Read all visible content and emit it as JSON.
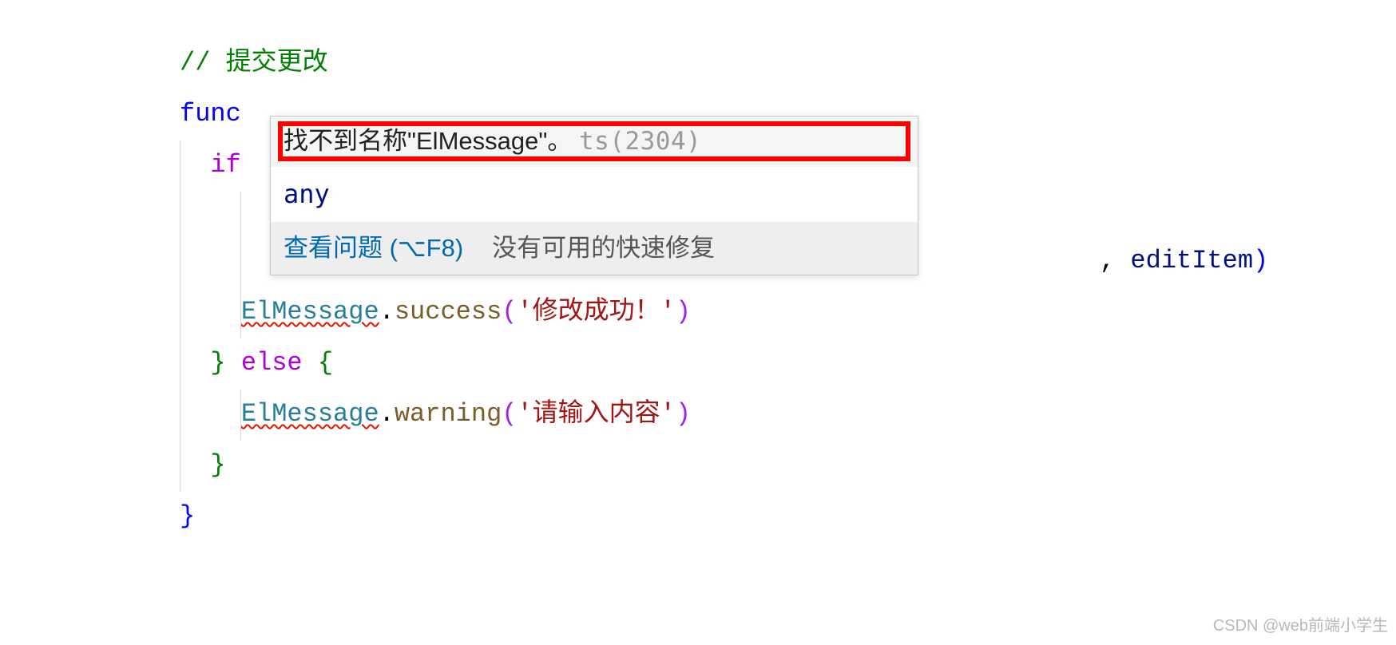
{
  "code": {
    "line1": {
      "comment_slash": "// ",
      "comment_text": "提交更改"
    },
    "line2": {
      "kw": "func"
    },
    "line3": {
      "kw": "if"
    },
    "line4_tail": {
      "comma": ", ",
      "var": "editItem",
      "paren": ")"
    },
    "line5": {
      "class": "ElMessage",
      "dot": ".",
      "method": "success",
      "paren_open": "(",
      "str": "'修改成功！'",
      "paren_close": ")"
    },
    "line6": {
      "brace_close": "}",
      "space": " ",
      "kw_else": "else",
      "space2": " ",
      "brace_open": "{"
    },
    "line7": {
      "class": "ElMessage",
      "dot": ".",
      "method": "warning",
      "paren_open": "(",
      "str": "'请输入内容'",
      "paren_close": ")"
    },
    "line8": {
      "brace": "}"
    },
    "line9": {
      "brace": "}"
    }
  },
  "hover": {
    "error_message": "找不到名称\"ElMessage\"。",
    "error_code": "ts(2304)",
    "type_info": "any",
    "view_problem": "查看问题 (⌥F8)",
    "no_quick_fix": "没有可用的快速修复"
  },
  "watermark": "CSDN @web前端小学生"
}
